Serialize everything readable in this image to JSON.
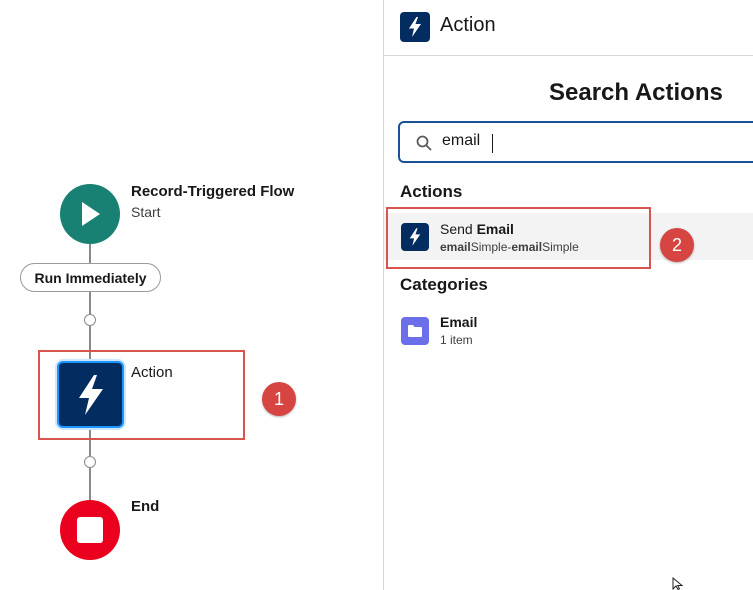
{
  "flow": {
    "start": {
      "title": "Record-Triggered Flow",
      "subtitle": "Start",
      "icon": "play-icon",
      "color": "#188173"
    },
    "run_path_label": "Run Immediately",
    "action_node": {
      "label": "Action",
      "icon": "lightning-bolt-icon",
      "color": "#032d60"
    },
    "end": {
      "title": "End",
      "icon": "stop-icon",
      "color": "#ea001e"
    }
  },
  "annotations": {
    "badge_1": "1",
    "badge_2": "2",
    "color": "#d64541"
  },
  "panel": {
    "header_title": "Action",
    "header_icon": "lightning-bolt-icon",
    "search_title": "Search Actions",
    "search": {
      "value": "email",
      "icon": "search-icon"
    },
    "actions_heading": "Actions",
    "actions": [
      {
        "title_prefix": "Send ",
        "title_bold": "Email",
        "sub_bold_1": "email",
        "sub_1": "Simple-",
        "sub_bold_2": "email",
        "sub_2": "Simple",
        "icon": "lightning-bolt-icon"
      }
    ],
    "categories_heading": "Categories",
    "categories": [
      {
        "title": "Email",
        "count": "1 item",
        "icon": "folder-icon",
        "color": "#6d6fea"
      }
    ]
  }
}
